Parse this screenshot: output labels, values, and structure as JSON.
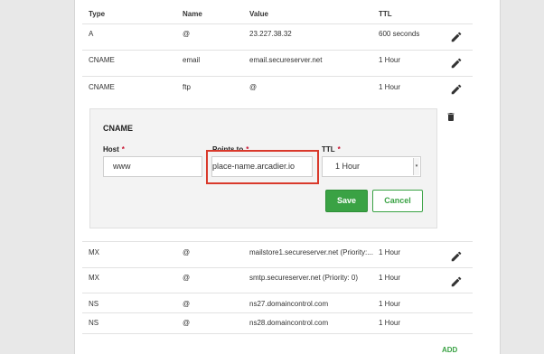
{
  "table": {
    "headers": {
      "type": "Type",
      "name": "Name",
      "value": "Value",
      "ttl": "TTL"
    },
    "top_rows": [
      {
        "type": "A",
        "name": "@",
        "value": "23.227.38.32",
        "ttl": "600 seconds"
      },
      {
        "type": "CNAME",
        "name": "email",
        "value": "email.secureserver.net",
        "ttl": "1 Hour"
      },
      {
        "type": "CNAME",
        "name": "ftp",
        "value": "@",
        "ttl": "1 Hour"
      }
    ],
    "bottom_rows": [
      {
        "type": "MX",
        "name": "@",
        "value": "mailstore1.secureserver.net (Priority:...",
        "ttl": "1 Hour"
      },
      {
        "type": "MX",
        "name": "@",
        "value": "smtp.secureserver.net (Priority: 0)",
        "ttl": "1 Hour"
      },
      {
        "type": "NS",
        "name": "@",
        "value": "ns27.domaincontrol.com",
        "ttl": "1 Hour"
      },
      {
        "type": "NS",
        "name": "@",
        "value": "ns28.domaincontrol.com",
        "ttl": "1 Hour"
      }
    ]
  },
  "edit": {
    "title": "CNAME",
    "host_label": "Host",
    "host_value": "www",
    "points_label": "Points to",
    "points_value": "place-name.arcadier.io",
    "ttl_label": "TTL",
    "ttl_value": "1 Hour",
    "required_mark": "*",
    "save_label": "Save",
    "cancel_label": "Cancel"
  },
  "add_label": "ADD",
  "colors": {
    "accent": "#3aa244",
    "highlight": "#d9392b",
    "required": "#c8102e"
  }
}
